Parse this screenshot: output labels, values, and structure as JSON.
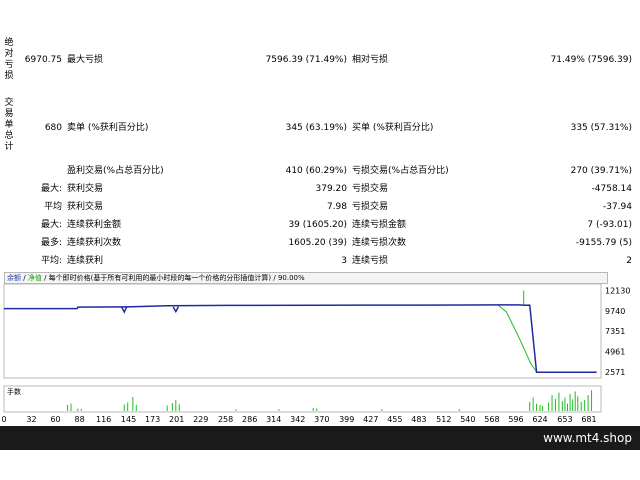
{
  "side_labels": {
    "absolute": [
      "绝",
      "对",
      "亏",
      "损"
    ],
    "total_trades": [
      "交",
      "易",
      "单",
      "总",
      "计"
    ]
  },
  "summary": {
    "absolute_drawdown": "6970.75",
    "max_drawdown_label": "最大亏损",
    "max_drawdown_value": "7596.39 (71.49%)",
    "relative_drawdown_label": "相对亏损",
    "relative_drawdown_value": "71.49% (7596.39)",
    "total_trades": "680",
    "short_label": "卖单 (%获利百分比)",
    "short_value": "345 (63.19%)",
    "long_label": "买单 (%获利百分比)",
    "long_value": "335 (57.31%)",
    "profit_trades_label": "盈利交易(%占总百分比)",
    "profit_trades_value": "410 (60.29%)",
    "loss_trades_label": "亏损交易(%占总百分比)",
    "loss_trades_value": "270 (39.71%)"
  },
  "rows": [
    {
      "prefix": "最大:",
      "left_label": "获利交易",
      "left_value": "379.20",
      "right_label": "亏损交易",
      "right_value": "-4758.14"
    },
    {
      "prefix": "平均",
      "left_label": "获利交易",
      "left_value": "7.98",
      "right_label": "亏损交易",
      "right_value": "-37.94"
    },
    {
      "prefix": "最大:",
      "left_label": "连续获利金额",
      "left_value": "39 (1605.20)",
      "right_label": "连续亏损金额",
      "right_value": "7 (-93.01)"
    },
    {
      "prefix": "最多:",
      "left_label": "连续获利次数",
      "left_value": "1605.20 (39)",
      "right_label": "连续亏损次数",
      "right_value": "-9155.79 (5)"
    },
    {
      "prefix": "平均:",
      "left_label": "连续获利",
      "left_value": "3",
      "right_label": "连续亏损",
      "right_value": "2"
    }
  ],
  "chart_header": {
    "balance": "余额",
    "equity": "净值",
    "model": "每个即时价格(基于所有可利用的最小时段的每一个价格的分形插值计算)",
    "quality": "90.00%"
  },
  "chart_data": {
    "type": "line",
    "series": [
      {
        "name": "余额",
        "color": "#1f2aa0",
        "x": [
          0,
          85,
          86,
          140,
          160,
          190,
          260,
          360,
          420,
          480,
          540,
          575,
          600,
          606,
          612,
          613,
          620,
          690
        ],
        "values": [
          10000,
          10000,
          10180,
          10210,
          10250,
          10350,
          10380,
          10400,
          10410,
          10420,
          10430,
          10440,
          10450,
          10400,
          10420,
          9500,
          2520,
          2520
        ]
      },
      {
        "name": "净值",
        "color": "#22bb22",
        "x": [
          540,
          575,
          585,
          600,
          613,
          620
        ],
        "values": [
          10430,
          10440,
          9600,
          6500,
          3600,
          2571
        ]
      }
    ],
    "balance_dips": [
      {
        "x": 140,
        "low": 9600
      },
      {
        "x": 200,
        "low": 9660
      }
    ],
    "equity_spike": {
      "x": 605,
      "low": 10300,
      "high": 12130
    },
    "y_ticks": [
      "12130",
      "9740",
      "7351",
      "4961",
      "2571"
    ],
    "y_tick_values": [
      12130,
      9740,
      7351,
      4961,
      2571
    ],
    "ylim": [
      1850,
      12900
    ],
    "x_ticks": [
      "0",
      "32",
      "60",
      "88",
      "116",
      "145",
      "173",
      "201",
      "229",
      "258",
      "286",
      "314",
      "342",
      "370",
      "399",
      "427",
      "455",
      "483",
      "512",
      "540",
      "568",
      "596",
      "624",
      "653",
      "681"
    ],
    "x_tick_values": [
      0,
      32,
      60,
      88,
      116,
      145,
      173,
      201,
      229,
      258,
      286,
      314,
      342,
      370,
      399,
      427,
      455,
      483,
      512,
      540,
      568,
      596,
      624,
      653,
      681
    ],
    "xlim": [
      0,
      695
    ],
    "lots_label": "手数",
    "lots": [
      {
        "x": 74,
        "v": 1.0
      },
      {
        "x": 78,
        "v": 1.2
      },
      {
        "x": 86,
        "v": 0.4
      },
      {
        "x": 90,
        "v": 0.3
      },
      {
        "x": 140,
        "v": 1.1
      },
      {
        "x": 144,
        "v": 1.4
      },
      {
        "x": 150,
        "v": 2.3
      },
      {
        "x": 154,
        "v": 1.0
      },
      {
        "x": 190,
        "v": 0.9
      },
      {
        "x": 196,
        "v": 1.3
      },
      {
        "x": 200,
        "v": 1.8
      },
      {
        "x": 204,
        "v": 1.1
      },
      {
        "x": 270,
        "v": 0.3
      },
      {
        "x": 320,
        "v": 0.3
      },
      {
        "x": 360,
        "v": 0.5
      },
      {
        "x": 364,
        "v": 0.4
      },
      {
        "x": 440,
        "v": 0.3
      },
      {
        "x": 530,
        "v": 0.3
      },
      {
        "x": 612,
        "v": 1.5
      },
      {
        "x": 616,
        "v": 2.2
      },
      {
        "x": 620,
        "v": 1.2
      },
      {
        "x": 624,
        "v": 1.0
      },
      {
        "x": 627,
        "v": 0.8
      },
      {
        "x": 634,
        "v": 1.4
      },
      {
        "x": 638,
        "v": 2.6
      },
      {
        "x": 642,
        "v": 2.0
      },
      {
        "x": 646,
        "v": 3.0
      },
      {
        "x": 650,
        "v": 1.6
      },
      {
        "x": 653,
        "v": 2.2
      },
      {
        "x": 656,
        "v": 1.2
      },
      {
        "x": 659,
        "v": 2.8
      },
      {
        "x": 662,
        "v": 1.9
      },
      {
        "x": 665,
        "v": 3.2
      },
      {
        "x": 668,
        "v": 2.4
      },
      {
        "x": 672,
        "v": 1.5
      },
      {
        "x": 676,
        "v": 1.8
      },
      {
        "x": 680,
        "v": 2.6
      },
      {
        "x": 684,
        "v": 3.4
      }
    ],
    "lots_max": 3.6
  },
  "brand": "www.mt4.shop"
}
